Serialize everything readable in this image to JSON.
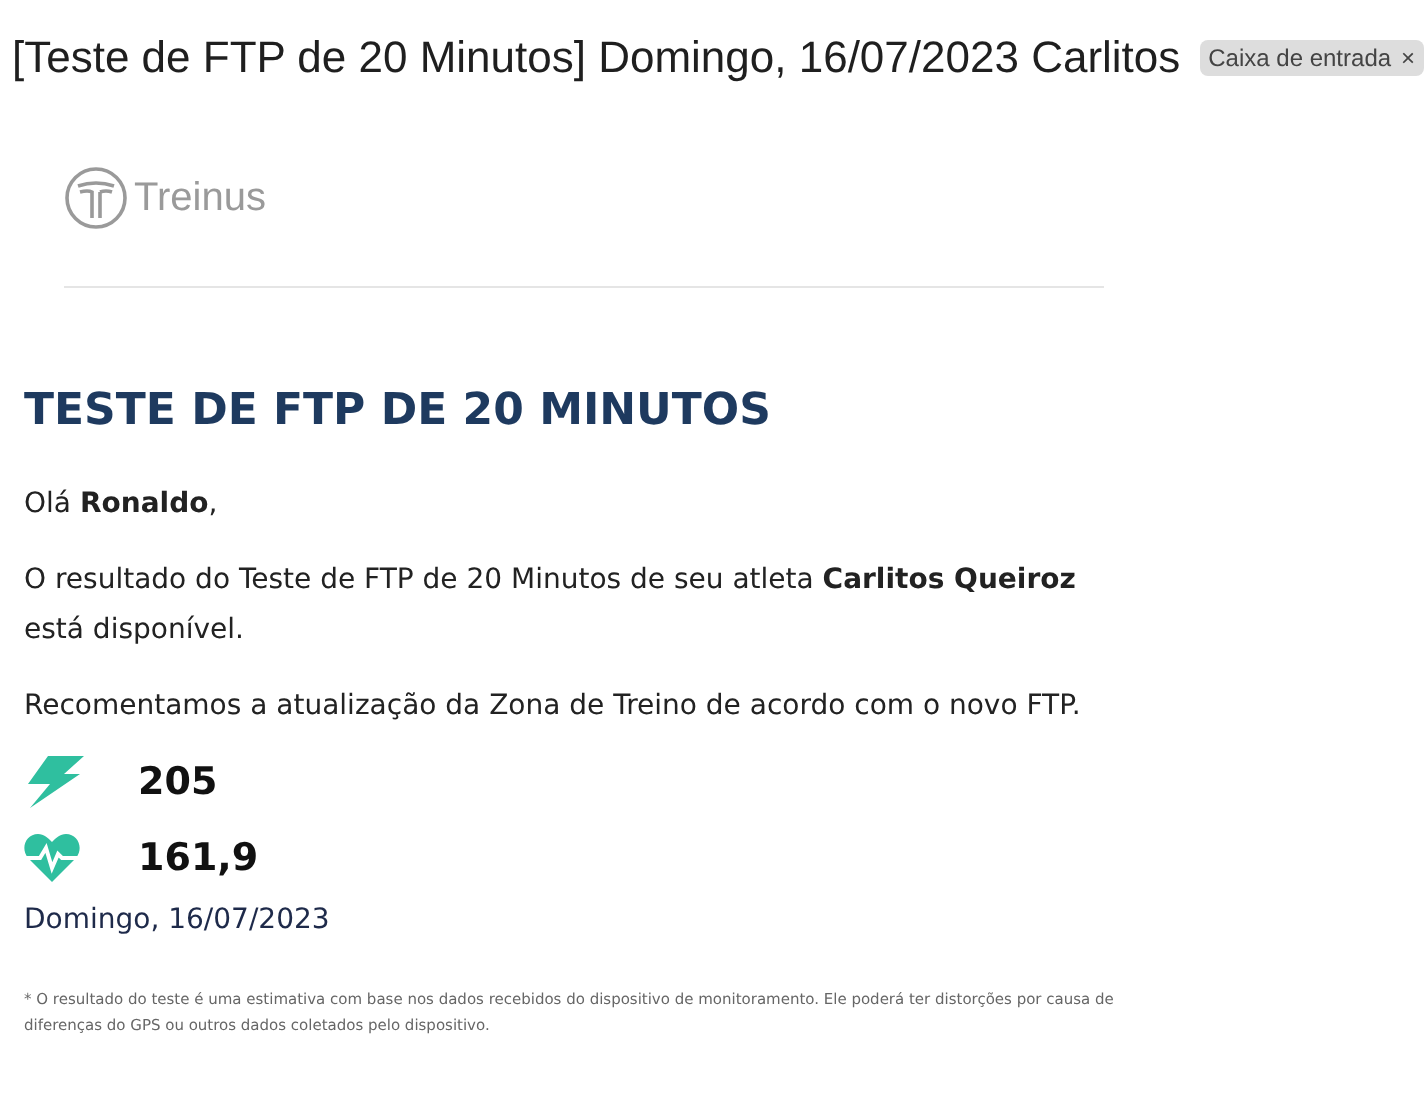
{
  "email": {
    "subject": "[Teste de FTP de 20 Minutos] Domingo, 16/07/2023 Carlitos",
    "label": "Caixa de entrada",
    "label_remove": "×"
  },
  "logo": {
    "text": "Treinus"
  },
  "heading": "TESTE DE FTP DE 20 MINUTOS",
  "paragraphs": [
    "Olá **Ronaldo**,",
    "O resultado do Teste de FTP de 20 Minutos de seu atleta **Carlitos Queiroz** está disponível.",
    "Recomentamos a atualização da Zona de Treino de acordo com o novo FTP."
  ],
  "metrics": [
    {
      "kind": "power",
      "value": "205"
    },
    {
      "kind": "heart",
      "value": "161,9"
    }
  ],
  "date": "Domingo, 16/07/2023",
  "footnote": "* O resultado do teste é uma estimativa com base nos dados recebidos do dispositivo de monitoramento. Ele poderá ter distorções por causa de diferenças do GPS ou outros dados coletados pelo dispositivo."
}
